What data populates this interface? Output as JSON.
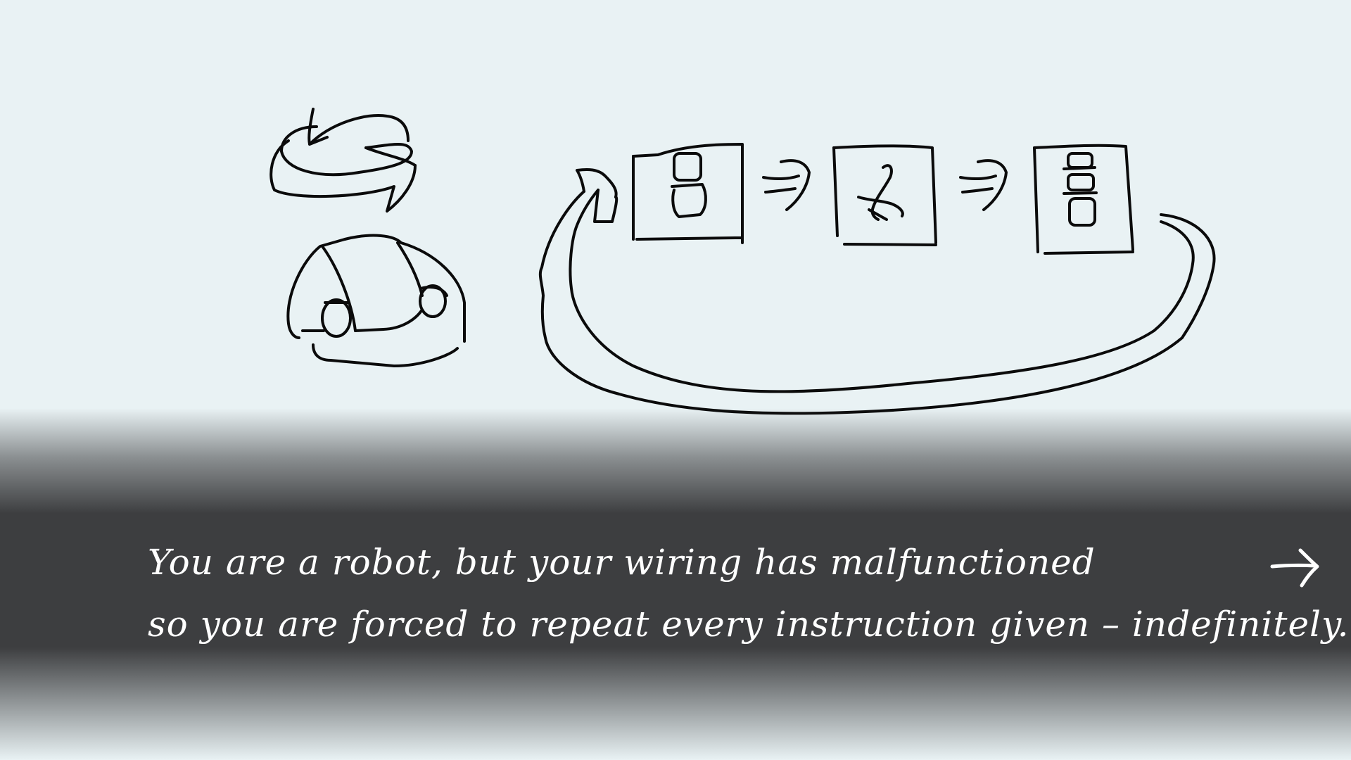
{
  "caption": {
    "line1": "You are a robot, but your wiring has malfunctioned",
    "line2": "so you are forced to repeat every instruction given – indefinitely.."
  },
  "icons": {
    "loop": "rotate-arrows-icon",
    "robot": "robot-icon",
    "card_1": "forward-step-icon",
    "card_2": "turn-step-icon",
    "card_3": "stack-step-icon",
    "next": "right-arrow-icon"
  },
  "colors": {
    "background": "#e9f2f4",
    "banner": "#3d3e40",
    "ink": "#0b0b0b",
    "caption_text": "#ffffff"
  }
}
